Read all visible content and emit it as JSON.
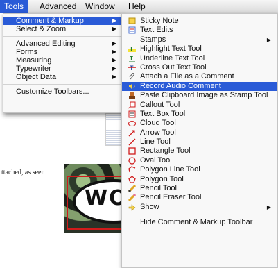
{
  "menubar": {
    "items": [
      {
        "label": "Tools",
        "active": true
      },
      {
        "label": "Advanced",
        "active": false
      },
      {
        "label": "Window",
        "active": false
      },
      {
        "label": "Help",
        "active": false
      }
    ]
  },
  "tools_menu": {
    "groups": [
      [
        {
          "label": "Comment & Markup",
          "submenu": true,
          "highlight": true
        },
        {
          "label": "Select & Zoom",
          "submenu": true
        }
      ],
      [
        {
          "label": "Advanced Editing",
          "submenu": true
        },
        {
          "label": "Forms",
          "submenu": true
        },
        {
          "label": "Measuring",
          "submenu": true
        },
        {
          "label": "Typewriter",
          "submenu": true
        },
        {
          "label": "Object Data",
          "submenu": true
        }
      ],
      [
        {
          "label": "Customize Toolbars..."
        }
      ]
    ]
  },
  "comment_menu": {
    "items": [
      {
        "label": "Sticky Note",
        "icon": "sticky-note-icon"
      },
      {
        "label": "Text Edits",
        "icon": "text-edits-icon"
      },
      {
        "label": "Stamps",
        "icon": "",
        "submenu": true
      },
      {
        "label": "Highlight Text Tool",
        "icon": "highlight-icon"
      },
      {
        "label": "Underline Text Tool",
        "icon": "underline-icon"
      },
      {
        "label": "Cross Out Text Tool",
        "icon": "cross-out-icon"
      },
      {
        "label": "Attach a File as a Comment",
        "icon": "paperclip-icon"
      },
      {
        "label": "Record Audio Comment",
        "icon": "speaker-icon",
        "highlight": true
      },
      {
        "label": "Paste Clipboard Image as Stamp Tool",
        "icon": "paste-stamp-icon"
      },
      {
        "label": "Callout Tool",
        "icon": "callout-icon"
      },
      {
        "label": "Text Box Tool",
        "icon": "text-box-icon"
      },
      {
        "label": "Cloud Tool",
        "icon": "cloud-icon"
      },
      {
        "label": "Arrow Tool",
        "icon": "arrow-icon"
      },
      {
        "label": "Line Tool",
        "icon": "line-icon"
      },
      {
        "label": "Rectangle Tool",
        "icon": "rectangle-icon"
      },
      {
        "label": "Oval Tool",
        "icon": "oval-icon"
      },
      {
        "label": "Polygon Line Tool",
        "icon": "polygon-line-icon"
      },
      {
        "label": "Polygon Tool",
        "icon": "polygon-icon"
      },
      {
        "label": "Pencil Tool",
        "icon": "pencil-icon"
      },
      {
        "label": "Pencil Eraser Tool",
        "icon": "eraser-icon"
      },
      {
        "label": "Show",
        "icon": "show-icon",
        "submenu": true
      }
    ],
    "footer": "Hide Comment & Markup Toolbar"
  },
  "document": {
    "text": "ttached, as seen",
    "stamp_text": "WOC"
  },
  "colors": {
    "highlight": "#2a5bd7",
    "markup_red": "#d01b1b"
  }
}
